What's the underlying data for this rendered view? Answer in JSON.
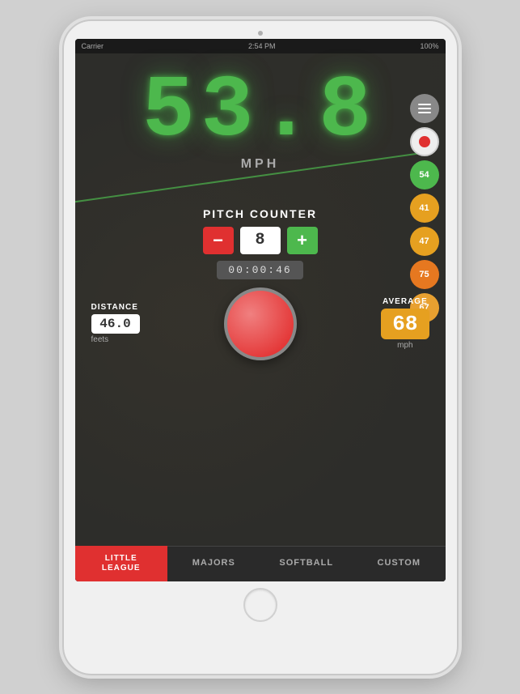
{
  "device": {
    "camera_alt": "front camera"
  },
  "status_bar": {
    "carrier": "Carrier",
    "time": "2:54 PM",
    "battery": "100%"
  },
  "speed": {
    "value": "53.8",
    "unit": "MPH"
  },
  "side_buttons": [
    {
      "id": "menu",
      "type": "menu",
      "label": ""
    },
    {
      "id": "record",
      "type": "record",
      "label": ""
    },
    {
      "id": "btn54",
      "type": "green",
      "label": "54"
    },
    {
      "id": "btn41",
      "type": "yellow",
      "label": "41"
    },
    {
      "id": "btn47",
      "type": "yellow",
      "label": "47"
    },
    {
      "id": "btn75",
      "type": "orange",
      "label": "75"
    },
    {
      "id": "btn67",
      "type": "light-orange",
      "label": "67"
    }
  ],
  "pitch_counter": {
    "label": "PITCH COUNTER",
    "value": "8",
    "minus_label": "−",
    "plus_label": "+",
    "timer": "00:00:46"
  },
  "distance": {
    "label": "DISTANCE",
    "value": "46.0",
    "unit": "feets"
  },
  "average": {
    "label": "AVERAGE",
    "value": "68",
    "unit": "mph"
  },
  "tabs": [
    {
      "id": "little-league",
      "label": "LITTLE\nLEAGUE",
      "active": true
    },
    {
      "id": "majors",
      "label": "MAJORS",
      "active": false
    },
    {
      "id": "softball",
      "label": "SOFTBALL",
      "active": false
    },
    {
      "id": "custom",
      "label": "CUSTOM",
      "active": false
    }
  ],
  "colors": {
    "accent_red": "#e03030",
    "accent_green": "#4db84d",
    "accent_yellow": "#e6a020",
    "accent_orange": "#e67820",
    "screen_bg": "#2d2d2a"
  }
}
